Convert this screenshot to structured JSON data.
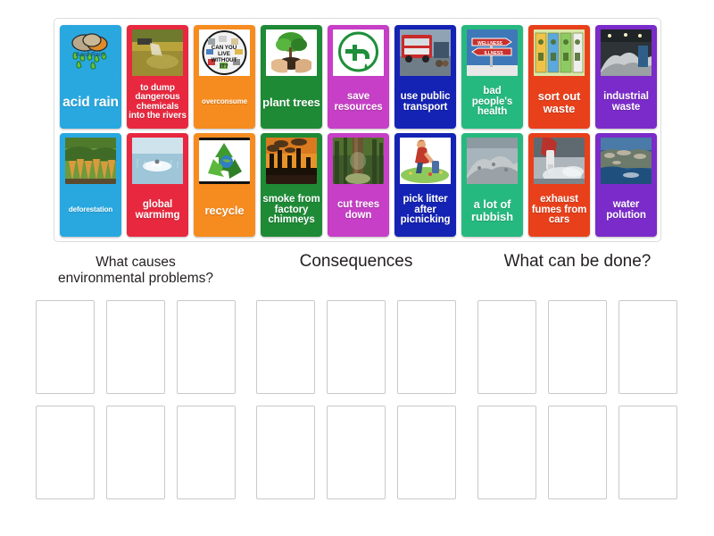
{
  "page": {
    "background": "#ffffff",
    "type": "group-sort-activity"
  },
  "tray": {
    "border_color": "#dcdcdc",
    "tiles": [
      {
        "label": "acid rain",
        "color": "#29A8E0",
        "art": "acid-rain-cloud-icon",
        "size": "xl",
        "row": 1,
        "col": 1
      },
      {
        "label": "to dump dangerous chemicals into the rivers",
        "color": "#E8283F",
        "art": "pipe-waste-river-photo",
        "size": "sm",
        "row": 1,
        "col": 2
      },
      {
        "label": "overconsume",
        "color": "#F68B1F",
        "art": "can-you-live-without-it-icon",
        "size": "xs",
        "row": 1,
        "col": 3
      },
      {
        "label": "plant trees",
        "color": "#1E8A36",
        "art": "hands-holding-sapling-photo",
        "size": "lg",
        "row": 1,
        "col": 4
      },
      {
        "label": "save resources",
        "color": "#C63FC6",
        "art": "water-tap-green-icon",
        "size": "md",
        "row": 1,
        "col": 5
      },
      {
        "label": "use public transport",
        "color": "#1423B4",
        "art": "red-bus-photo",
        "size": "md",
        "row": 1,
        "col": 6
      },
      {
        "label": "bad people's health",
        "color": "#26B97F",
        "art": "wellness-illness-signpost-photo",
        "size": "md",
        "row": 1,
        "col": 7
      },
      {
        "label": "sort out waste",
        "color": "#E8401B",
        "art": "recycling-bins-icon",
        "size": "lg",
        "row": 1,
        "col": 8
      },
      {
        "label": "industrial waste",
        "color": "#7B2BC9",
        "art": "factory-scrap-heap-photo",
        "size": "md",
        "row": 1,
        "col": 9
      },
      {
        "label": "deforestation",
        "color": "#29A8E0",
        "art": "cut-forest-stumps-photo",
        "size": "xs",
        "row": 2,
        "col": 1
      },
      {
        "label": "global warmimg",
        "color": "#E8283F",
        "art": "melting-iceberg-photo",
        "size": "md",
        "row": 2,
        "col": 2
      },
      {
        "label": "recycle",
        "color": "#F68B1F",
        "art": "recycle-arrows-globe-icon",
        "size": "lg",
        "row": 2,
        "col": 3
      },
      {
        "label": "smoke from factory chimneys",
        "color": "#1E8A36",
        "art": "smokestacks-sunset-photo",
        "size": "md",
        "row": 2,
        "col": 4
      },
      {
        "label": "cut trees down",
        "color": "#C63FC6",
        "art": "forest-tree-trunk-photo",
        "size": "md",
        "row": 2,
        "col": 5
      },
      {
        "label": "pick litter after picnicking",
        "color": "#1423B4",
        "art": "person-picking-litter-icon",
        "size": "md",
        "row": 2,
        "col": 6
      },
      {
        "label": "a lot of rubbish",
        "color": "#26B97F",
        "art": "rubbish-heap-photo",
        "size": "lg",
        "row": 2,
        "col": 7
      },
      {
        "label": "exhaust fumes from cars",
        "color": "#E8401B",
        "art": "car-exhaust-pipe-photo",
        "size": "md",
        "row": 2,
        "col": 8
      },
      {
        "label": "water polution",
        "color": "#7B2BC9",
        "art": "polluted-water-photo",
        "size": "md",
        "row": 2,
        "col": 9
      }
    ]
  },
  "buckets": {
    "slot_border_color": "#c9c9c9",
    "groups": [
      {
        "title": "What causes\nenvironmental problems?",
        "title_line1": "What causes",
        "title_line2": "environmental problems?",
        "slots": 6
      },
      {
        "title": "Consequences",
        "title_line1": "Consequences",
        "title_line2": "",
        "slots": 6
      },
      {
        "title": "What can be done?",
        "title_line1": "What can be done?",
        "title_line2": "",
        "slots": 6
      }
    ]
  }
}
